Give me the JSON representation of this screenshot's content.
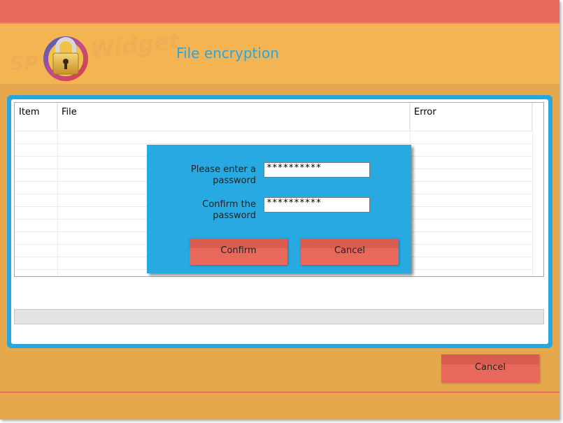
{
  "app": {
    "logo_left": "SP",
    "logo_right": "Widget",
    "title": "File encryption"
  },
  "table": {
    "columns": [
      "Item",
      "File",
      "Error"
    ]
  },
  "progress": {
    "value": 0
  },
  "footer": {
    "cancel_label": "Cancel"
  },
  "dialog": {
    "password_label_line1": "Please enter a",
    "password_label_line2": "password",
    "password_value": "**********",
    "confirm_label_line1": "Confirm the",
    "confirm_label_line2": "password",
    "confirm_value": "**********",
    "confirm_button": "Confirm",
    "cancel_button": "Cancel"
  },
  "colors": {
    "top_bar": "#e8695b",
    "header": "#f4b452",
    "frame": "#29a6dd",
    "button": "#e8695b"
  }
}
